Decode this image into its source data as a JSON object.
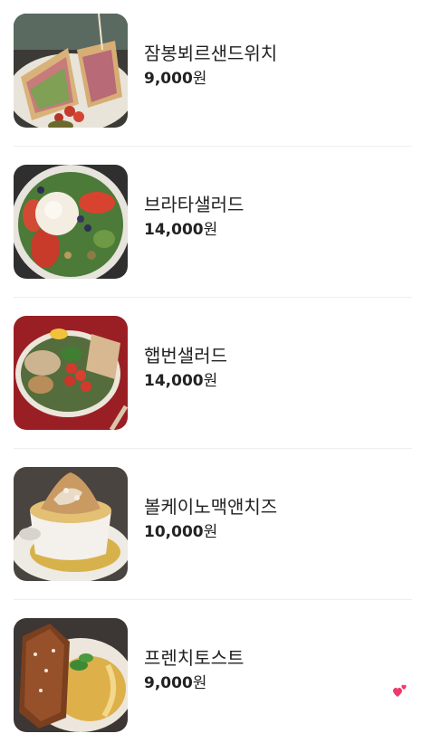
{
  "colors": {
    "text": "#222222",
    "divider": "#eeeeee",
    "heart": "#f0386b"
  },
  "menu": {
    "items": [
      {
        "name": "잠봉뵈르샌드위치",
        "price": "9,000",
        "unit": "원",
        "photo": "sandwich-photo"
      },
      {
        "name": "브라타샐러드",
        "price": "14,000",
        "unit": "원",
        "photo": "burrata-salad-photo"
      },
      {
        "name": "햅번샐러드",
        "price": "14,000",
        "unit": "원",
        "photo": "hepburn-salad-photo"
      },
      {
        "name": "볼케이노맥앤치즈",
        "price": "10,000",
        "unit": "원",
        "photo": "volcano-mac-and-cheese-photo"
      },
      {
        "name": "프렌치토스트",
        "price": "9,000",
        "unit": "원",
        "photo": "french-toast-photo"
      }
    ]
  },
  "icons": {
    "floating": "hearts-icon"
  }
}
